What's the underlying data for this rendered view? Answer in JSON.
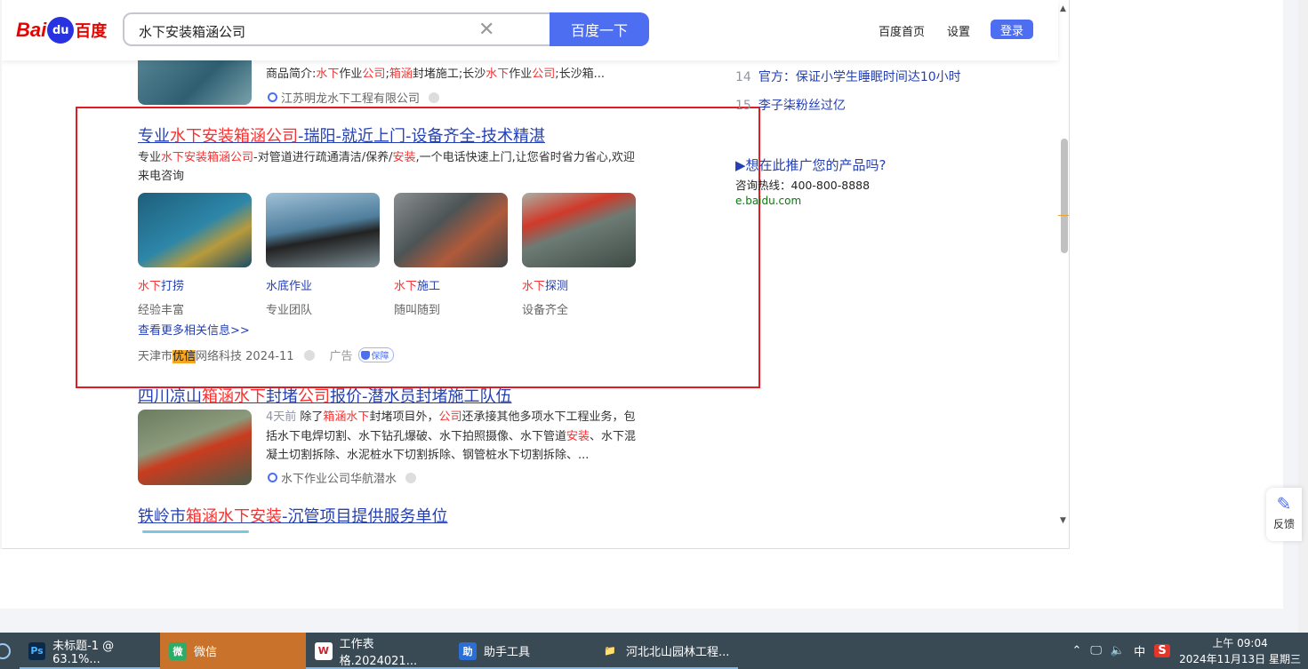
{
  "header": {
    "logo_latin": "Bai",
    "logo_paw": "du",
    "logo_cn": "百度",
    "search_value": "水下安装箱涵公司",
    "search_button": "百度一下",
    "links": [
      "百度首页",
      "设置"
    ],
    "login": "登录"
  },
  "top_result": {
    "snippet_parts": [
      "商品简介:",
      "水下",
      "作业",
      "公司",
      ";",
      "箱涵",
      "封堵施工;长沙",
      "水下",
      "作业",
      "公司",
      ";长沙箱..."
    ],
    "source": "江苏明龙水下工程有限公司"
  },
  "ad": {
    "title_parts": [
      "专业",
      "水下安装箱涵公司",
      "-瑞阳-就近上门-设备齐全-技术精湛"
    ],
    "desc_parts": [
      "专业",
      "水下安装箱涵公司",
      "-对管道进行疏通清洁/保养/",
      "安装",
      ",一个电话快速上门,让您省时省力省心,欢迎来电咨询"
    ],
    "cards": [
      {
        "title_red": "水下",
        "title_rest": "打捞",
        "sub": "经验丰富",
        "color": "#2c6f8a"
      },
      {
        "title_red": "",
        "title_rest": "水底作业",
        "sub": "专业团队",
        "color": "#4a7a96"
      },
      {
        "title_red": "水下",
        "title_rest": "施工",
        "sub": "随叫随到",
        "color": "#5b6a6e"
      },
      {
        "title_red": "水下",
        "title_rest": "探测",
        "sub": "设备齐全",
        "color": "#6f7c6a"
      }
    ],
    "more": "查看更多相关信息>>",
    "footer_pre": "天津市",
    "footer_hl": "优信",
    "footer_post": "网络科技 2024-11",
    "ad_label": "广告",
    "guard": "保障"
  },
  "result2": {
    "title_parts": [
      "四川凉山",
      "箱涵水下",
      "封堵",
      "公司",
      "报价-潜水员封堵施工队伍"
    ],
    "time": "4天前",
    "text_parts": [
      " 除了",
      "箱涵水下",
      "封堵项目外，",
      "公司",
      "还承接其他多项水下工程业务，包括水下电焊切割、水下钻孔爆破、水下拍照摄像、水下管道",
      "安装",
      "、水下混凝土切割拆除、水泥桩水下切割拆除、钢管桩水下切割拆除、..."
    ],
    "source": "水下作业公司华航潜水"
  },
  "result3": {
    "title_parts": [
      "铁岭市",
      "箱涵水下安装",
      "-沉管项目提供服务单位"
    ]
  },
  "hotlist": [
    {
      "num": "14",
      "text": "官方：保证小学生睡眠时间达10小时"
    },
    {
      "num": "15",
      "text": "李子柒粉丝过亿"
    }
  ],
  "promo": {
    "title": "▶想在此推广您的产品吗?",
    "phone": "咨询热线：400-800-8888",
    "url": "e.baidu.com"
  },
  "feedback": "反馈",
  "taskbar": {
    "items": [
      {
        "icon": "Ps",
        "label": "未标题-1 @ 63.1%...",
        "icon_color": "#0b2a4a",
        "active": false
      },
      {
        "icon": "微",
        "label": "微信",
        "icon_color": "#2aae67",
        "active": true
      },
      {
        "icon": "W",
        "label": "工作表格.2024021...",
        "icon_color": "#c8242b",
        "active": false
      },
      {
        "icon": "助",
        "label": "助手工具",
        "icon_color": "#2a6fd6",
        "active": false
      },
      {
        "icon": "📁",
        "label": "河北北山园林工程...",
        "icon_color": "#e6b94a",
        "active": false
      }
    ],
    "ime": "中",
    "time": "上午 09:04",
    "date": "2024年11月13日 星期三"
  }
}
